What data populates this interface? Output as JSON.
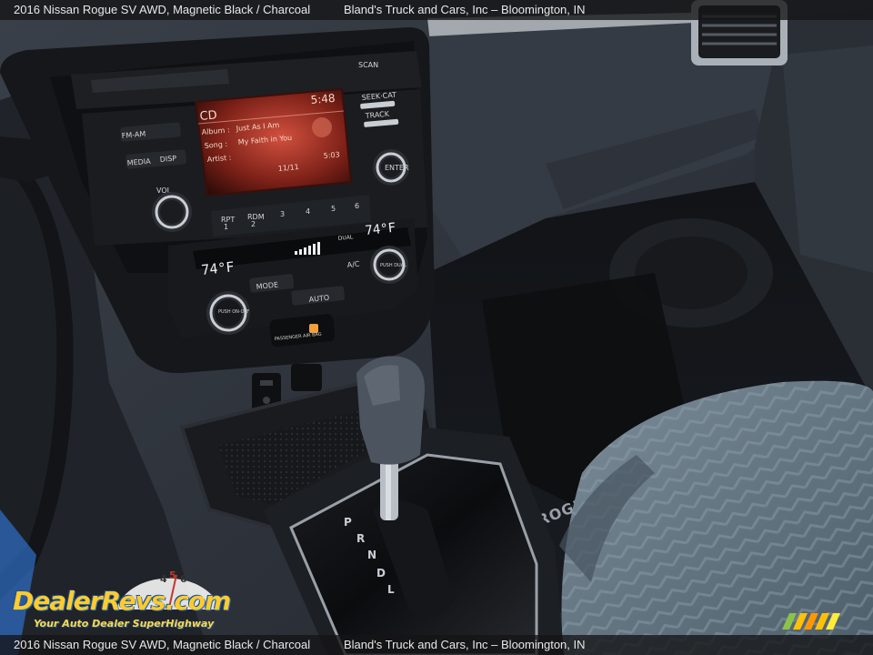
{
  "caption": {
    "vehicle": "2016 Nissan Rogue SV AWD,  Magnetic Black / Charcoal",
    "dealer": "Bland's Truck and Cars, Inc – Bloomington, IN"
  },
  "radio": {
    "source": "CD",
    "clock": "5:48",
    "album_label": "Album :",
    "album": "Just As I Am",
    "song_label": "Song :",
    "song": "My Faith in You",
    "artist_label": "Artist :",
    "elapsed": "5:03",
    "track": "11/11",
    "buttons": {
      "fm_am": "FM-AM",
      "media": "MEDIA",
      "disp": "DISP",
      "vol": "VOL",
      "scan": "SCAN",
      "seek": "SEEK·CAT",
      "track_btn": "TRACK",
      "enter": "ENTER",
      "presets": [
        "RPT",
        "RDM",
        "3",
        "4",
        "5",
        "6"
      ],
      "preset_sub": [
        "1",
        "2"
      ]
    }
  },
  "climate": {
    "temp_left": "74°F",
    "temp_right": "74°F",
    "dual": "DUAL",
    "mode": "MODE",
    "auto": "AUTO",
    "ac": "A/C",
    "push_off": "PUSH ON·OFF",
    "push_dual": "PUSH DUAL",
    "airbag": "PASSENGER AIR BAG",
    "gear_letters": [
      "P",
      "R",
      "N",
      "D",
      "L"
    ]
  },
  "floor_mat": "ROGUE",
  "watermark": {
    "name": "DealerRevs.com",
    "tagline": "Your Auto Dealer SuperHighway",
    "dial_digits": [
      "4",
      "5",
      "6"
    ]
  },
  "colors": {
    "dash": "#2b3038",
    "screen_glow": "#c0392b",
    "seat": "#5f7180",
    "trim_chrome": "#b9bec6",
    "watermark_yellow": "#ffcb2e",
    "watermark_blue": "#2b6fb3"
  }
}
